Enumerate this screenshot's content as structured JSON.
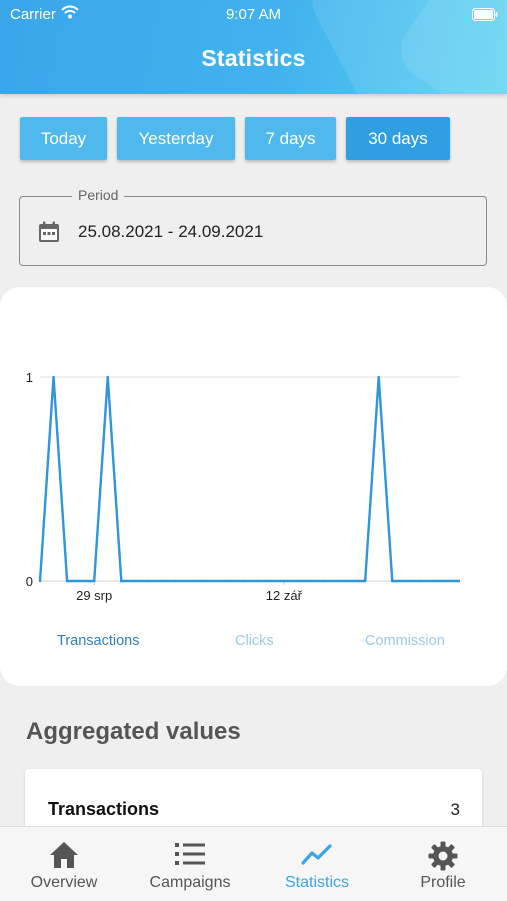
{
  "status_bar": {
    "carrier": "Carrier",
    "time": "9:07 AM"
  },
  "header": {
    "title": "Statistics"
  },
  "period_buttons": [
    {
      "label": "Today",
      "active": false
    },
    {
      "label": "Yesterday",
      "active": false
    },
    {
      "label": "7 days",
      "active": false
    },
    {
      "label": "30 days",
      "active": true
    }
  ],
  "period": {
    "label": "Period",
    "value": "25.08.2021 - 24.09.2021"
  },
  "chart_data": {
    "type": "line",
    "series": [
      {
        "name": "Transactions",
        "values": [
          0,
          1,
          0,
          0,
          0,
          1,
          0,
          0,
          0,
          0,
          0,
          0,
          0,
          0,
          0,
          0,
          0,
          0,
          0,
          0,
          0,
          0,
          0,
          0,
          0,
          1,
          0,
          0,
          0,
          0,
          0
        ]
      }
    ],
    "y_ticks": [
      "0",
      "1"
    ],
    "ylim": [
      0,
      1
    ],
    "x_tick_labels": [
      "29 srp",
      "12 zář"
    ],
    "grid": true,
    "color": "#2f95dc"
  },
  "chart_tabs": [
    {
      "label": "Transactions",
      "active": true
    },
    {
      "label": "Clicks",
      "active": false
    },
    {
      "label": "Commission",
      "active": false
    }
  ],
  "aggregated": {
    "title": "Aggregated values",
    "items": [
      {
        "label": "Transactions",
        "value": "3"
      }
    ]
  },
  "nav": [
    {
      "label": "Overview",
      "icon": "home-icon",
      "active": false
    },
    {
      "label": "Campaigns",
      "icon": "list-icon",
      "active": false
    },
    {
      "label": "Statistics",
      "icon": "chart-icon",
      "active": true
    },
    {
      "label": "Profile",
      "icon": "gear-icon",
      "active": false
    }
  ],
  "colors": {
    "accent": "#3aa5e6",
    "header_start": "#3aa6ea",
    "header_end": "#57d0f1"
  }
}
